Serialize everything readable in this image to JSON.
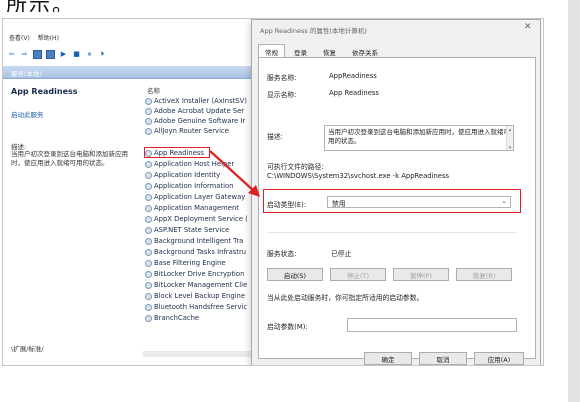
{
  "article": {
    "top_text": "所示。"
  },
  "services": {
    "menu": [
      "查看(V)",
      "帮助(H)"
    ],
    "header_band": "服务(本地)",
    "selected_title": "App Readiness",
    "start_link": "启动此服务",
    "desc_head": "描述:",
    "desc_body": "当用户初次登录到这台电脑和添加新应用时，使应用进入就绪可用的状态。",
    "col_name": "名称",
    "items": [
      "ActiveX Installer (AxInstSV)",
      "Adobe Acrobat Update Ser",
      "Adobe Genuine Software Ir",
      "AllJoyn Router Service",
      "App Readiness",
      "Application Host Helper",
      "Application Identity",
      "Application Information",
      "Application Layer Gateway",
      "Application Management",
      "AppX Deployment Service (",
      "ASP.NET State Service",
      "Background Intelligent Tra",
      "Background Tasks Infrastru",
      "Base Filtering Engine",
      "BitLocker Drive Encryption",
      "BitLocker Management Clie",
      "Block Level Backup Engine",
      "Bluetooth Handsfree Servic",
      "BranchCache"
    ],
    "bottom_tabs": "\\扩展/标准/"
  },
  "dialog": {
    "title": "App Readiness 的属性(本地计算机)",
    "tabs": [
      "常规",
      "登录",
      "恢复",
      "依存关系"
    ],
    "service_name_label": "服务名称:",
    "service_name": "AppReadiness",
    "display_name_label": "显示名称:",
    "display_name": "App Readiness",
    "desc_label": "描述:",
    "desc": "当用户初次登录到这台电脑和添加新应用时，使应用进入就绪可用的状态。",
    "exe_label": "可执行文件的路径:",
    "exe_path": "C:\\WINDOWS\\System32\\svchost.exe -k AppReadiness",
    "startup_label": "启动类型(E):",
    "startup_value": "禁用",
    "status_label": "服务状态:",
    "status_value": "已停止",
    "buttons": {
      "start": "启动(S)",
      "stop": "停止(T)",
      "pause": "暂停(P)",
      "resume": "恢复(R)"
    },
    "hint": "当从此处启动服务时，你可指定所适用的启动参数。",
    "params_label": "启动参数(M):",
    "ok": "确定",
    "cancel": "取消",
    "apply": "应用(A)"
  },
  "colors": {
    "highlight": "#e02020",
    "link": "#1d5fb0"
  }
}
